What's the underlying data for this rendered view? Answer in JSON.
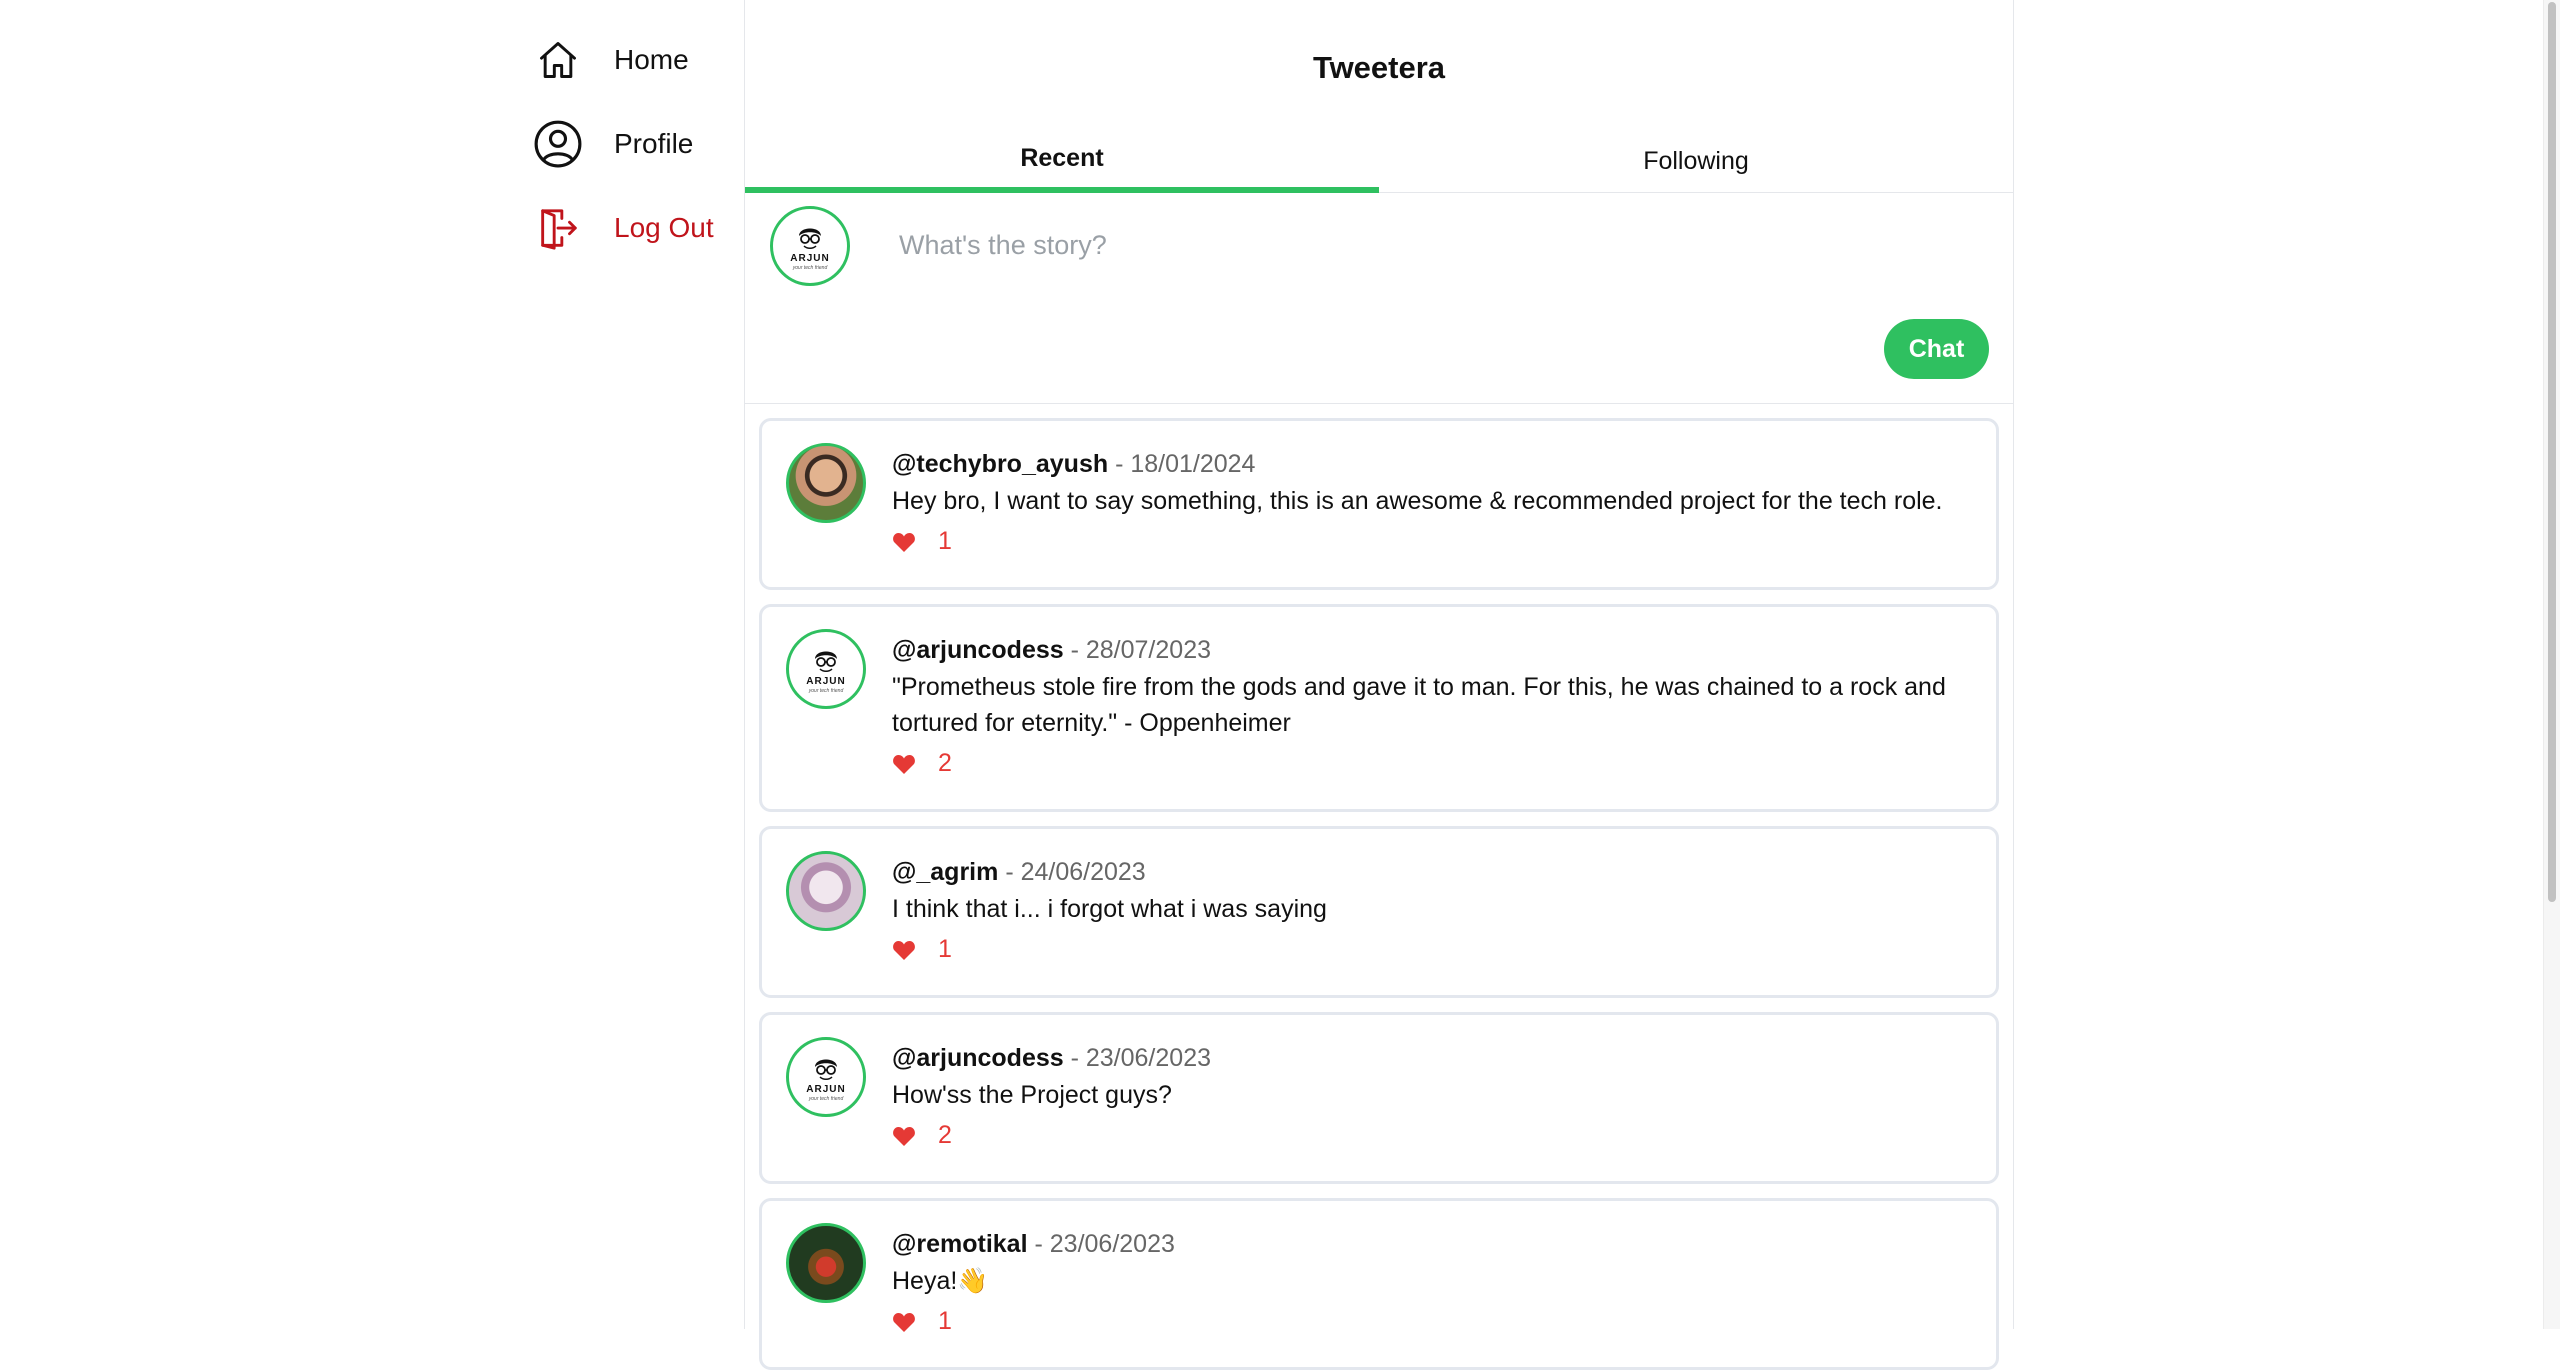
{
  "sidebar": {
    "items": [
      {
        "label": "Home",
        "icon": "home-icon"
      },
      {
        "label": "Profile",
        "icon": "user-circle-icon"
      },
      {
        "label": "Log Out",
        "icon": "logout-icon",
        "color": "#c0141b"
      }
    ]
  },
  "header": {
    "title": "Tweetera"
  },
  "tabs": [
    {
      "label": "Recent",
      "active": true
    },
    {
      "label": "Following",
      "active": false
    }
  ],
  "composer": {
    "placeholder": "What's the story?",
    "button_label": "Chat",
    "avatar_text": "ARJUN",
    "avatar_tagline": "your tech friend"
  },
  "colors": {
    "accent": "#2fc060",
    "like": "#e53935",
    "logout": "#c0141b"
  },
  "posts": [
    {
      "handle": "@techybro_ayush",
      "date": " - 18/01/2024",
      "text": "Hey bro, I want to say something, this is an awesome & recommended project for the tech role.",
      "likes": "1"
    },
    {
      "handle": "@arjuncodess",
      "date": " - 28/07/2023",
      "text": "\"Prometheus stole fire from the gods and gave it to man. For this, he was chained to a rock and tortured for eternity.\" - Oppenheimer",
      "likes": "2"
    },
    {
      "handle": "@_agrim",
      "date": " - 24/06/2023",
      "text": "I think that i... i forgot what i was saying",
      "likes": "1"
    },
    {
      "handle": "@arjuncodess",
      "date": " - 23/06/2023",
      "text": "How'ss the Project guys?",
      "likes": "2"
    },
    {
      "handle": "@remotikal",
      "date": " - 23/06/2023",
      "text": "Heya!👋",
      "likes": "1"
    }
  ]
}
